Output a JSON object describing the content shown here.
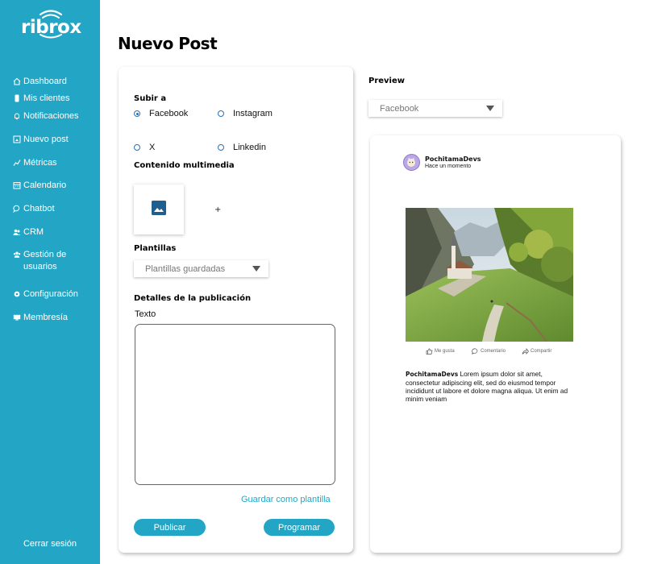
{
  "brand": {
    "name": "ribrox"
  },
  "sidebar": {
    "items": [
      {
        "label": "Dashboard",
        "icon": "home-icon"
      },
      {
        "label": "Mis clientes",
        "icon": "phone-icon"
      },
      {
        "label": "Notificaciones",
        "icon": "bell-icon"
      },
      {
        "label": "Nuevo post",
        "icon": "new-post-icon"
      },
      {
        "label": "Métricas",
        "icon": "metrics-icon"
      },
      {
        "label": "Calendario",
        "icon": "calendar-icon"
      },
      {
        "label": "Chatbot",
        "icon": "chat-icon"
      },
      {
        "label": "CRM",
        "icon": "crm-icon"
      },
      {
        "label": "Gestión de usuarios",
        "icon": "users-icon"
      },
      {
        "label": "Configuración",
        "icon": "gear-icon"
      },
      {
        "label": "Membresía",
        "icon": "membership-icon"
      }
    ],
    "logout_label": "Cerrar sesión"
  },
  "page": {
    "title": "Nuevo Post"
  },
  "form": {
    "upload_label": "Subir a",
    "networks": [
      {
        "label": "Facebook",
        "checked": true
      },
      {
        "label": "Instagram",
        "checked": false
      },
      {
        "label": "X",
        "checked": false
      },
      {
        "label": "Linkedin",
        "checked": false
      }
    ],
    "media_label": "Contenido multimedia",
    "add_media_label": "+",
    "templates_label": "Plantillas",
    "templates_select": "Plantillas guardadas",
    "details_label": "Detalles de la publicación",
    "text_label": "Texto",
    "text_value": "",
    "save_template_label": "Guardar como plantilla",
    "publish_label": "Publicar",
    "schedule_label": "Programar"
  },
  "preview": {
    "title": "Preview",
    "network_select": "Facebook",
    "account_name": "PochitamaDevs",
    "time": "Hace un momento",
    "actions": [
      {
        "label": "Me gusta",
        "icon": "thumbs-up-icon"
      },
      {
        "label": "Comentario",
        "icon": "comment-icon"
      },
      {
        "label": "Compartir",
        "icon": "share-icon"
      }
    ],
    "caption_user": "PochitamaDevs",
    "caption_text": " Lorem ipsum dolor sit amet, consectetur adipiscing elit, sed do eiusmod tempor incididunt ut labore et dolore magna aliqua. Ut enim ad minim veniam"
  },
  "colors": {
    "accent": "#23a6c6",
    "radio": "#2d6fb0",
    "image_icon": "#1f5f8f"
  }
}
